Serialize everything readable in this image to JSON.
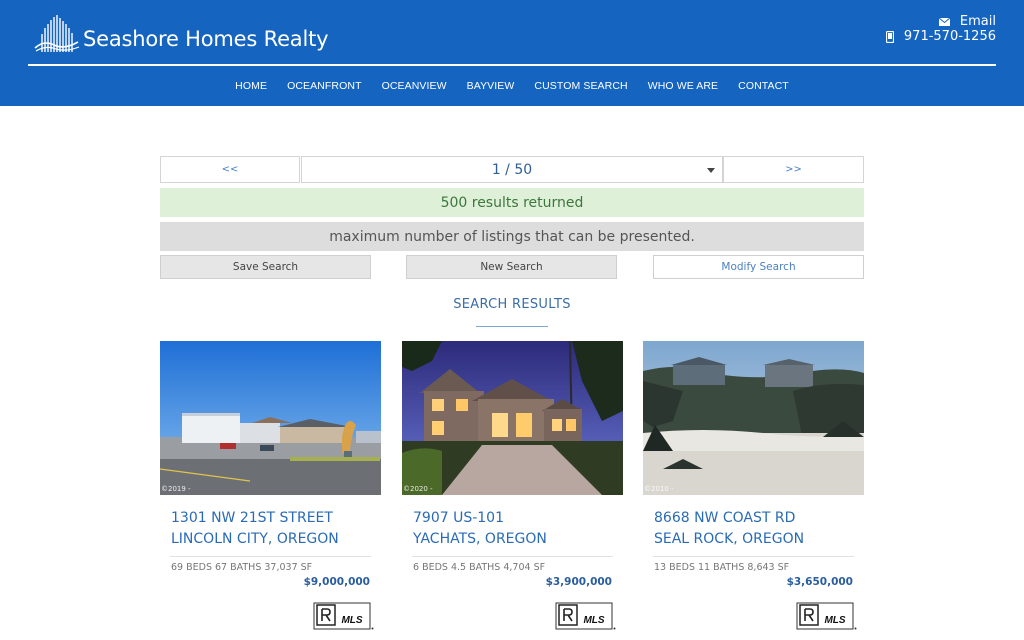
{
  "brand": {
    "name": "Seashore Homes Realty"
  },
  "contact": {
    "email_label": "Email",
    "phone": "971-570-1256"
  },
  "nav": [
    "HOME",
    "OCEANFRONT",
    "OCEANVIEW",
    "BAYVIEW",
    "CUSTOM SEARCH",
    "WHO WE ARE",
    "CONTACT"
  ],
  "pager": {
    "prev": "<<",
    "current": "1 / 50",
    "next": ">>"
  },
  "results": {
    "count_text": "500 results returned",
    "max_text": "maximum number of listings that can be presented."
  },
  "buttons": {
    "save": "Save Search",
    "new": "New Search",
    "modify": "Modify Search"
  },
  "section": {
    "heading": "SEARCH RESULTS"
  },
  "listings": [
    {
      "street": "1301 NW 21ST STREET",
      "city": "LINCOLN CITY, OREGON",
      "specs": "69 BEDS 67 BATHS 37,037 SF",
      "price": "$9,000,000",
      "copyright": "©2019 -"
    },
    {
      "street": "7907 US-101",
      "city": "YACHATS, OREGON",
      "specs": "6 BEDS 4.5 BATHS 4,704 SF",
      "price": "$3,900,000",
      "copyright": "©2020 -"
    },
    {
      "street": "8668 NW COAST RD",
      "city": "SEAL ROCK, OREGON",
      "specs": "13 BEDS 11 BATHS 8,643 SF",
      "price": "$3,650,000",
      "copyright": "©2010 -"
    }
  ],
  "mls_label": "MLS",
  "colors": {
    "header_bg": "#1565c0",
    "link": "#2a6bb5",
    "success_bg": "#dff0d8",
    "muted_bg": "#dddddd"
  },
  "icons": {
    "email": "envelope-icon",
    "phone": "mobile-phone-icon",
    "dropdown": "caret-down-icon",
    "mls": "realtor-mls-logo"
  }
}
